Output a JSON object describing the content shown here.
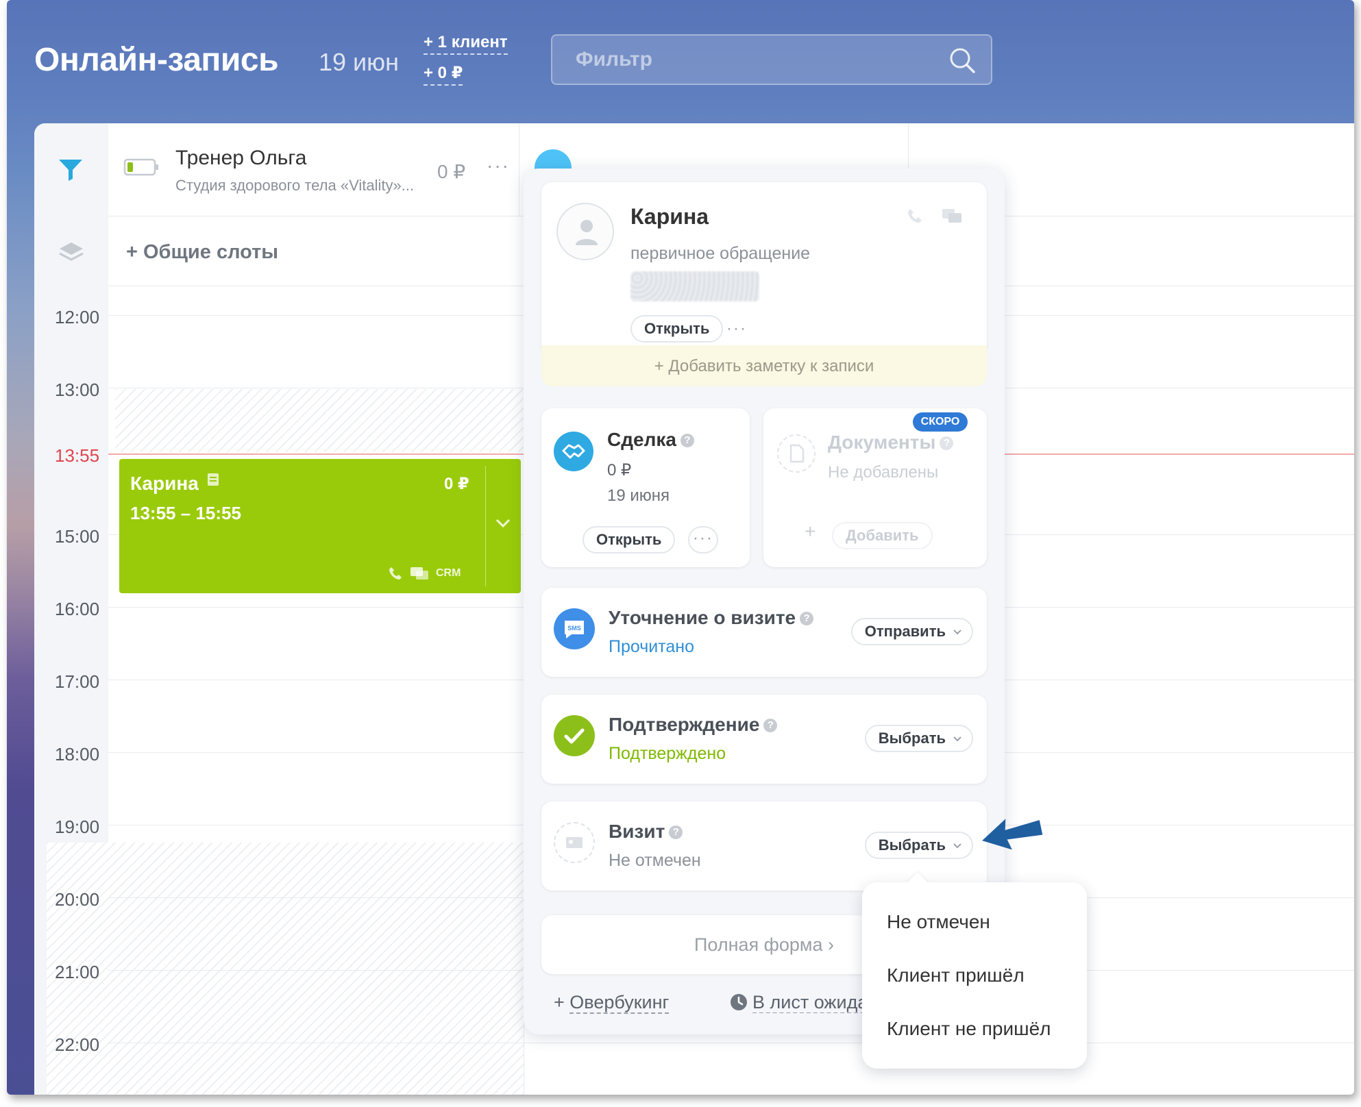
{
  "header": {
    "title": "Онлайн-запись",
    "date": "19 июн",
    "stat_clients": "+ 1 клиент",
    "stat_amount": "+ 0 ₽",
    "filter_placeholder": "Фильтр"
  },
  "resource": {
    "name": "Тренер Ольга",
    "subtitle": "Студия здорового тела «Vitality»...",
    "amount": "0 ₽",
    "more": "···"
  },
  "slots": {
    "label": "+ Общие слоты"
  },
  "timeline": {
    "hours": [
      "12:00",
      "13:00",
      "15:00",
      "16:00",
      "17:00",
      "18:00",
      "19:00",
      "20:00",
      "21:00",
      "22:00"
    ],
    "now_label": "13:55"
  },
  "event": {
    "name": "Карина",
    "time": "13:55 – 15:55",
    "amount": "0 ₽",
    "crm_label": "CRM",
    "color": "#9acb0a"
  },
  "popup": {
    "client": {
      "name": "Карина",
      "type": "первичное обращение",
      "open_label": "Открыть",
      "more": "···"
    },
    "note_label": "+ Добавить заметку к записи",
    "deal": {
      "title": "Сделка",
      "amount": "0 ₽",
      "date": "19 июня",
      "open_label": "Открыть",
      "more": "···"
    },
    "docs": {
      "badge": "СКОРО",
      "title": "Документы",
      "status": "Не добавлены",
      "add_label": "Добавить"
    },
    "sms": {
      "title": "Уточнение о визите",
      "status": "Прочитано",
      "action": "Отправить"
    },
    "confirm": {
      "title": "Подтверждение",
      "status": "Подтверждено",
      "action": "Выбрать"
    },
    "visit": {
      "title": "Визит",
      "status": "Не отмечен",
      "action": "Выбрать"
    },
    "full_form": "Полная форма ›",
    "overbooking": "Овербукинг",
    "waitlist": "В лист ожидания"
  },
  "visit_menu": {
    "options": [
      "Не отмечен",
      "Клиент пришёл",
      "Клиент не пришёл"
    ]
  },
  "colors": {
    "accent_blue": "#2f8fd8",
    "confirm_green": "#7fb800",
    "now_red": "#e0454e",
    "annotation_arrow": "#1f5fa0"
  }
}
